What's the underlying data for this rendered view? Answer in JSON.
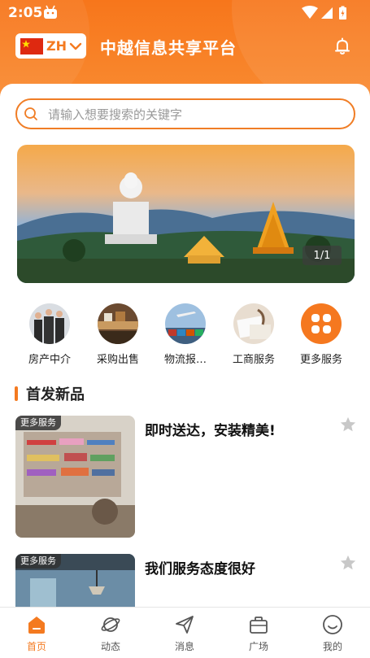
{
  "status": {
    "time": "2:05"
  },
  "header": {
    "language_code": "ZH",
    "title": "中越信息共享平台"
  },
  "search": {
    "placeholder": "请输入想要搜索的关键字"
  },
  "banner": {
    "indicator": "1/1"
  },
  "services": [
    {
      "label": "房产中介",
      "icon": "real-estate-photo"
    },
    {
      "label": "采购出售",
      "icon": "purchase-photo"
    },
    {
      "label": "物流报…",
      "icon": "logistics-photo"
    },
    {
      "label": "工商服务",
      "icon": "business-photo"
    },
    {
      "label": "更多服务",
      "icon": "grid-icon"
    }
  ],
  "section": {
    "title": "首发新品"
  },
  "products": [
    {
      "tag": "更多服务",
      "title": "即时送达，安装精美!"
    },
    {
      "tag": "更多服务",
      "title": "我们服务态度很好"
    }
  ],
  "tabbar": [
    {
      "label": "首页",
      "icon": "home-icon",
      "active": true
    },
    {
      "label": "动态",
      "icon": "planet-icon",
      "active": false
    },
    {
      "label": "消息",
      "icon": "send-icon",
      "active": false
    },
    {
      "label": "广场",
      "icon": "briefcase-icon",
      "active": false
    },
    {
      "label": "我的",
      "icon": "smile-icon",
      "active": false
    }
  ],
  "colors": {
    "accent": "#f47a20",
    "header": "#f7761b"
  }
}
